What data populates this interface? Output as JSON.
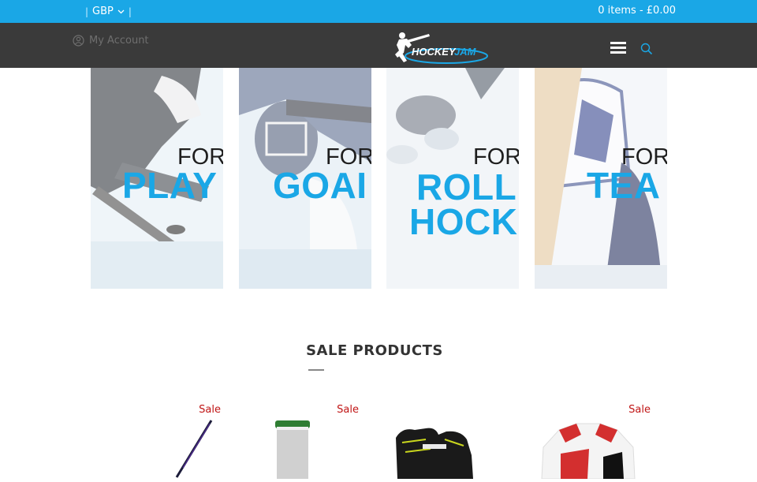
{
  "topbar": {
    "currency": "GBP",
    "cart": "0 items - £0.00"
  },
  "header": {
    "account_label": "My Account",
    "logo_alt": "HOCKEYJAM"
  },
  "banners": [
    {
      "for": "FOR",
      "title": "PLAY"
    },
    {
      "for": "FOR",
      "title": "GOAI"
    },
    {
      "for": "FOR",
      "title_line1": "ROLL",
      "title_line2": "HOCK"
    },
    {
      "for": "FOR",
      "title": "TEA"
    }
  ],
  "section": {
    "title": "SALE PRODUCTS"
  },
  "products": [
    {
      "badge": "Sale",
      "icon": "hockey-stick-icon"
    },
    {
      "badge": "Sale",
      "icon": "sock-icon"
    },
    {
      "badge": "",
      "icon": "glove-icon"
    },
    {
      "badge": "Sale",
      "icon": "jersey-icon"
    }
  ],
  "colors": {
    "accent": "#1aa7e6",
    "header": "#3a3a3a",
    "sale": "#c01515"
  }
}
